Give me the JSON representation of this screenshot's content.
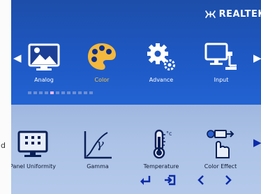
{
  "bezel": {
    "label": "d"
  },
  "brand": {
    "name": "REALTEK",
    "mark_icon": "realtek-crab-logo"
  },
  "nav": {
    "prev_icon": "triangle-left-icon",
    "next_icon": "triangle-right-icon"
  },
  "categories": [
    {
      "label": "Analog",
      "icon": "monitor-landscape-icon",
      "active": false
    },
    {
      "label": "Color",
      "icon": "palette-icon",
      "active": true
    },
    {
      "label": "Advance",
      "icon": "gears-icon",
      "active": false
    },
    {
      "label": "Input",
      "icon": "pc-input-icon",
      "active": false
    }
  ],
  "page_indicator": {
    "count": 12,
    "active_index": 4
  },
  "submenu": [
    {
      "label": "Panel Uniformity",
      "icon": "panel-grid-icon"
    },
    {
      "label": "Gamma",
      "icon": "gamma-curve-icon"
    },
    {
      "label": "Temperature",
      "icon": "thermometer-icon"
    },
    {
      "label": "Color Effect",
      "icon": "color-effect-icon"
    }
  ],
  "keys": {
    "enter_icon": "enter-arrow-icon",
    "exit_icon": "exit-icon",
    "left_icon": "chevron-left-icon",
    "right_icon": "chevron-right-icon"
  },
  "colors": {
    "osd_blue": "#1f4fb0",
    "active_label": "#f6c648",
    "key_blue": "#0b2ba8",
    "submenu_bg": "#adc3e7"
  }
}
